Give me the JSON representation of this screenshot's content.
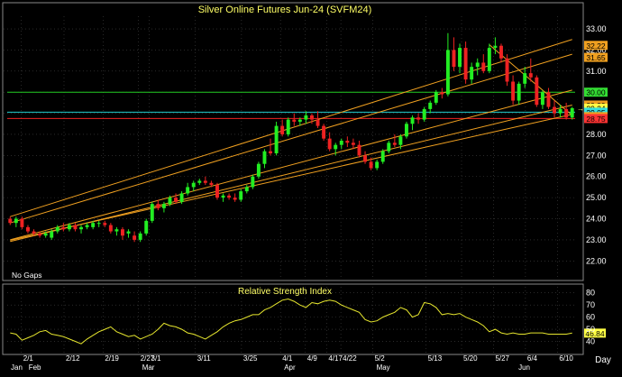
{
  "chart_data": [
    {
      "type": "candlestick",
      "title": "Silver Online Futures Jun-24 (SVFM24)",
      "annotation": "No Gaps",
      "ylim": [
        21.2,
        33.6
      ],
      "yticks": [
        "33.00",
        "32.00",
        "31.00",
        "30.00",
        "29.00",
        "28.00",
        "27.00",
        "26.00",
        "25.00",
        "24.00",
        "23.00",
        "22.00"
      ],
      "ytick_values": [
        33,
        32,
        31,
        30,
        29,
        28,
        27,
        26,
        25,
        24,
        23,
        22
      ],
      "price_labels": [
        {
          "text": "32.22",
          "value": 32.22,
          "bg": "#f0a020"
        },
        {
          "text": "31.65",
          "value": 31.65,
          "bg": "#f0a020"
        },
        {
          "text": "30.00",
          "value": 30.0,
          "bg": "#33dd33"
        },
        {
          "text": "29.39",
          "value": 29.39,
          "bg": "#f0a020"
        },
        {
          "text": "29.24",
          "value": 29.24,
          "bg": "#ffff44"
        },
        {
          "text": "29.05",
          "value": 29.05,
          "bg": "#33dddd"
        },
        {
          "text": "28.84",
          "value": 28.84,
          "bg": "#f0a020"
        },
        {
          "text": "28.75",
          "value": 28.75,
          "bg": "#ff3333"
        }
      ],
      "horizontal_levels": [
        {
          "value": 30.0,
          "color": "#22cc22"
        },
        {
          "value": 29.05,
          "color": "#22cccc"
        },
        {
          "value": 28.75,
          "color": "#ee2222"
        }
      ],
      "candles": [
        [
          24.0,
          24.1,
          23.7,
          23.8
        ],
        [
          23.8,
          24.1,
          23.6,
          24.0
        ],
        [
          24.0,
          24.1,
          23.5,
          23.6
        ],
        [
          23.6,
          23.7,
          23.3,
          23.4
        ],
        [
          23.4,
          23.5,
          23.2,
          23.3
        ],
        [
          23.3,
          23.4,
          23.1,
          23.2
        ],
        [
          23.2,
          23.4,
          23.1,
          23.3
        ],
        [
          23.1,
          23.5,
          23.0,
          23.4
        ],
        [
          23.4,
          23.7,
          23.3,
          23.6
        ],
        [
          23.6,
          23.8,
          23.4,
          23.5
        ],
        [
          23.5,
          23.8,
          23.4,
          23.7
        ],
        [
          23.7,
          23.8,
          23.4,
          23.5
        ],
        [
          23.5,
          23.7,
          23.3,
          23.6
        ],
        [
          23.6,
          23.8,
          23.5,
          23.7
        ],
        [
          23.6,
          23.9,
          23.5,
          23.8
        ],
        [
          23.8,
          23.9,
          23.6,
          23.8
        ],
        [
          23.8,
          23.9,
          23.6,
          23.7
        ],
        [
          23.7,
          23.8,
          23.3,
          23.4
        ],
        [
          23.4,
          23.6,
          23.2,
          23.5
        ],
        [
          23.5,
          23.6,
          23.0,
          23.2
        ],
        [
          23.3,
          23.5,
          23.1,
          23.4
        ],
        [
          23.2,
          23.4,
          22.9,
          23.0
        ],
        [
          23.0,
          23.4,
          22.9,
          23.3
        ],
        [
          23.3,
          24.0,
          23.2,
          23.9
        ],
        [
          23.9,
          24.8,
          23.8,
          24.7
        ],
        [
          24.7,
          24.9,
          24.4,
          24.5
        ],
        [
          24.5,
          24.8,
          24.3,
          24.7
        ],
        [
          24.7,
          25.1,
          24.6,
          25.0
        ],
        [
          25.0,
          25.2,
          24.7,
          24.8
        ],
        [
          24.8,
          25.3,
          24.7,
          25.2
        ],
        [
          25.2,
          25.7,
          25.1,
          25.5
        ],
        [
          25.5,
          25.8,
          25.3,
          25.7
        ],
        [
          25.7,
          25.9,
          25.6,
          25.8
        ],
        [
          25.8,
          26.0,
          25.6,
          25.7
        ],
        [
          25.7,
          25.8,
          25.5,
          25.6
        ],
        [
          25.6,
          25.7,
          24.9,
          25.0
        ],
        [
          25.0,
          25.2,
          24.8,
          25.1
        ],
        [
          25.1,
          25.2,
          24.9,
          25.0
        ],
        [
          25.0,
          25.2,
          24.8,
          24.9
        ],
        [
          24.9,
          25.4,
          24.8,
          25.3
        ],
        [
          25.3,
          25.6,
          25.2,
          25.5
        ],
        [
          25.5,
          26.1,
          25.4,
          26.0
        ],
        [
          26.0,
          26.7,
          25.9,
          26.6
        ],
        [
          26.6,
          27.3,
          26.4,
          27.2
        ],
        [
          27.2,
          27.8,
          27.0,
          27.1
        ],
        [
          27.1,
          28.6,
          27.0,
          28.4
        ],
        [
          28.4,
          28.7,
          27.9,
          28.0
        ],
        [
          28.0,
          28.8,
          27.9,
          28.7
        ],
        [
          28.7,
          29.0,
          28.4,
          28.6
        ],
        [
          28.6,
          28.8,
          28.4,
          28.7
        ],
        [
          28.7,
          29.1,
          28.5,
          28.9
        ],
        [
          28.9,
          29.0,
          28.5,
          28.7
        ],
        [
          28.7,
          29.1,
          28.3,
          28.4
        ],
        [
          28.4,
          28.5,
          27.7,
          27.8
        ],
        [
          27.8,
          28.1,
          27.2,
          27.3
        ],
        [
          27.3,
          27.6,
          27.0,
          27.5
        ],
        [
          27.5,
          27.8,
          27.3,
          27.7
        ],
        [
          27.7,
          27.9,
          27.4,
          27.6
        ],
        [
          27.6,
          27.8,
          27.3,
          27.5
        ],
        [
          27.5,
          27.7,
          26.9,
          27.0
        ],
        [
          27.0,
          27.2,
          26.6,
          26.7
        ],
        [
          26.7,
          26.9,
          26.3,
          26.4
        ],
        [
          26.4,
          26.8,
          26.3,
          26.7
        ],
        [
          26.7,
          27.3,
          26.6,
          27.2
        ],
        [
          27.2,
          27.7,
          27.1,
          27.6
        ],
        [
          27.6,
          28.0,
          27.4,
          27.5
        ],
        [
          27.5,
          28.0,
          27.3,
          27.9
        ],
        [
          27.9,
          28.6,
          27.8,
          28.5
        ],
        [
          28.5,
          28.9,
          28.2,
          28.8
        ],
        [
          28.8,
          29.0,
          28.5,
          28.7
        ],
        [
          28.7,
          29.3,
          28.6,
          29.2
        ],
        [
          29.2,
          29.6,
          29.0,
          29.5
        ],
        [
          29.5,
          30.1,
          29.4,
          30.0
        ],
        [
          30.0,
          30.2,
          29.7,
          29.9
        ],
        [
          29.9,
          32.8,
          29.8,
          32.0
        ],
        [
          32.0,
          32.6,
          31.0,
          31.2
        ],
        [
          31.2,
          32.3,
          30.9,
          32.1
        ],
        [
          32.1,
          32.4,
          30.4,
          30.6
        ],
        [
          30.6,
          31.4,
          30.4,
          31.2
        ],
        [
          31.2,
          31.6,
          30.8,
          31.4
        ],
        [
          31.4,
          31.8,
          30.9,
          31.0
        ],
        [
          31.0,
          32.3,
          30.9,
          32.1
        ],
        [
          32.1,
          32.6,
          31.8,
          32.2
        ],
        [
          32.2,
          32.3,
          31.4,
          31.6
        ],
        [
          31.6,
          31.8,
          30.3,
          30.5
        ],
        [
          30.5,
          30.8,
          29.4,
          29.6
        ],
        [
          29.6,
          30.5,
          29.4,
          30.4
        ],
        [
          30.4,
          31.2,
          30.2,
          30.9
        ],
        [
          30.9,
          31.6,
          30.5,
          30.7
        ],
        [
          30.7,
          30.8,
          29.3,
          29.4
        ],
        [
          29.4,
          30.1,
          29.2,
          30.0
        ],
        [
          30.0,
          30.2,
          29.2,
          29.3
        ],
        [
          29.3,
          29.6,
          28.8,
          29.0
        ],
        [
          29.0,
          29.4,
          28.8,
          29.2
        ],
        [
          29.2,
          29.5,
          28.7,
          28.8
        ],
        [
          28.8,
          29.3,
          28.7,
          29.24
        ]
      ],
      "trendlines": [
        {
          "points": [
            [
              "0",
              "23.00"
            ],
            [
              "95",
              "30.10"
            ]
          ]
        },
        {
          "points": [
            [
              "0",
              "22.98"
            ],
            [
              "95",
              "28.95"
            ]
          ]
        },
        {
          "points": [
            [
              "0",
              "22.92"
            ],
            [
              "95",
              "29.39"
            ]
          ]
        },
        {
          "points": [
            [
              "0",
              "24.10"
            ],
            [
              "95",
              "32.50"
            ]
          ]
        },
        {
          "points": [
            [
              "0",
              "23.80"
            ],
            [
              "95",
              "31.80"
            ]
          ]
        },
        {
          "points": [
            [
              "81",
              "32.25"
            ],
            [
              "95",
              "28.90"
            ]
          ]
        }
      ]
    },
    {
      "type": "line",
      "title": "Relative Strength Index",
      "ylim": [
        30,
        85
      ],
      "yticks": [
        "80",
        "70",
        "60",
        "50",
        "40"
      ],
      "ytick_values": [
        80,
        70,
        60,
        50,
        40
      ],
      "last_value_label": "46.84",
      "last_value": 46.84,
      "series": [
        {
          "color": "#e6e62e",
          "values": [
            47,
            46,
            41,
            43,
            45,
            48,
            49,
            46,
            45,
            44,
            42,
            40,
            38,
            42,
            45,
            48,
            50,
            52,
            48,
            46,
            44,
            45,
            42,
            44,
            46,
            50,
            55,
            53,
            52,
            50,
            47,
            46,
            44,
            42,
            45,
            48,
            52,
            55,
            57,
            58,
            60,
            62,
            62,
            66,
            68,
            71,
            74,
            75,
            73,
            70,
            68,
            72,
            71,
            73,
            74,
            73,
            70,
            68,
            66,
            64,
            58,
            56,
            57,
            60,
            62,
            64,
            68,
            66,
            60,
            62,
            72,
            71,
            68,
            62,
            63,
            62,
            63,
            60,
            58,
            56,
            53,
            48,
            50,
            47,
            46,
            47,
            46,
            46,
            47,
            47,
            47,
            46,
            46,
            46,
            46,
            46.84
          ]
        }
      ]
    }
  ],
  "x_axis": {
    "top_labels": [
      "2/1",
      "2/12",
      "2/19",
      "2/27",
      "3/1",
      "3/11",
      "3/25",
      "4/1",
      "4/9",
      "4/17",
      "4/22",
      "5/2",
      "5/13",
      "5/20",
      "5/27",
      "6/4",
      "6/10"
    ],
    "top_label_index": [
      4,
      16,
      27,
      37,
      40,
      53,
      66,
      77,
      84,
      90,
      94,
      103,
      118,
      128,
      137,
      146,
      155
    ],
    "month_labels": [
      "Jan",
      "Feb",
      "Mar",
      "Apr",
      "May",
      "Jun"
    ],
    "month_label_index": [
      0,
      5,
      37,
      77,
      103,
      143
    ],
    "period": "Day"
  },
  "colors": {
    "up": "#22ee22",
    "down": "#ee2222",
    "grid": "#444444",
    "trend": "#f0a020",
    "axis_text": "#ffffff",
    "title_text": "#ffff66"
  }
}
